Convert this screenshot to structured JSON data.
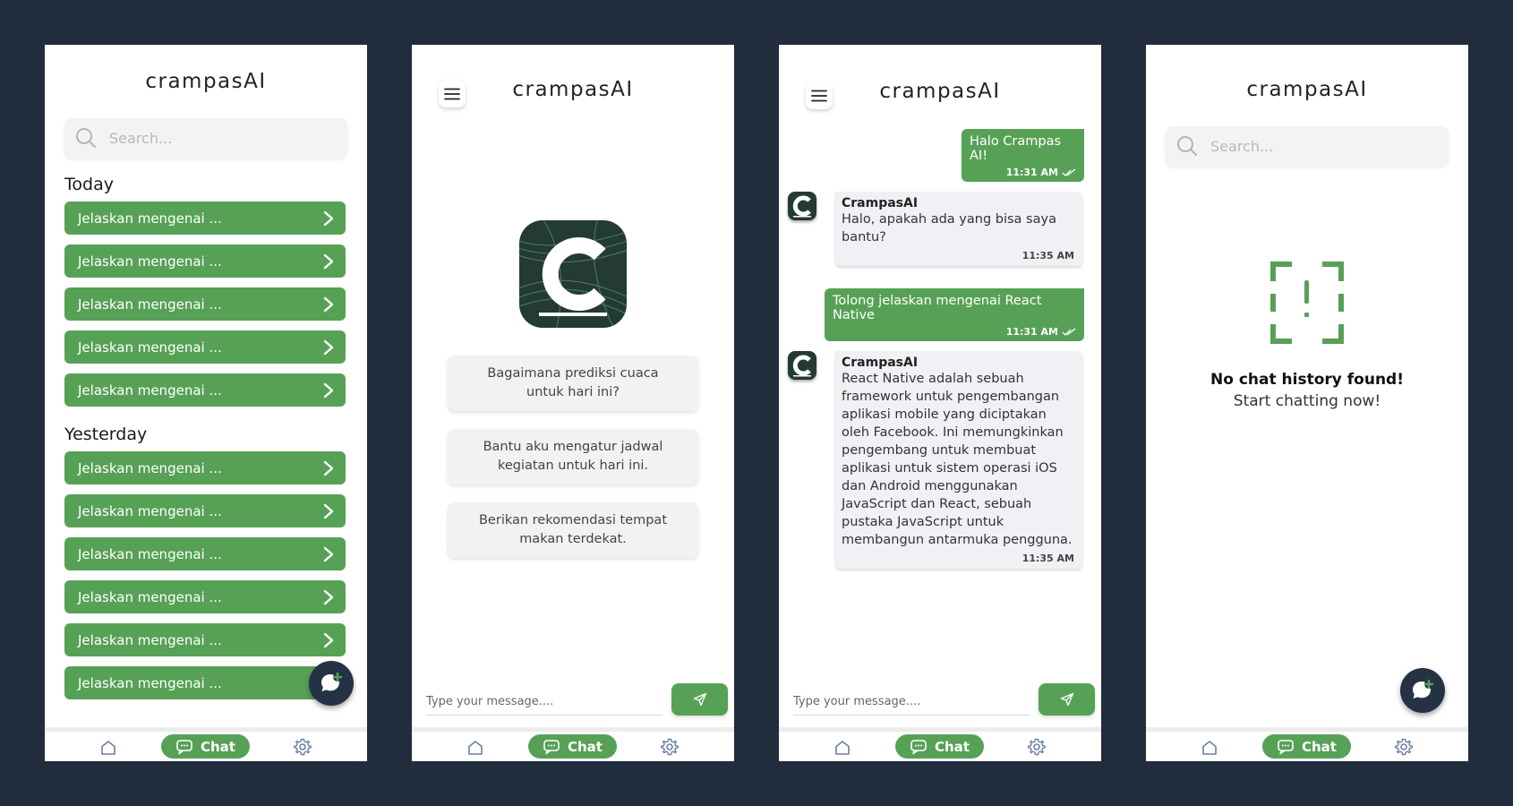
{
  "app": {
    "title": "crampasAI"
  },
  "colors": {
    "background": "#212d3d",
    "accent": "#57a157",
    "fab": "#243244",
    "logo_bg": "#233a35"
  },
  "search": {
    "placeholder": "Search..."
  },
  "history": {
    "today_label": "Today",
    "yesterday_label": "Yesterday",
    "item_label": "Jelaskan mengenai ...",
    "today_count": 5,
    "yesterday_count": 6
  },
  "nav": {
    "chat_label": "Chat",
    "home_icon": "home-icon",
    "settings_icon": "gear-icon"
  },
  "suggestions": [
    "Bagaimana prediksi cuaca untuk hari ini?",
    "Bantu aku mengatur jadwal kegiatan untuk hari ini.",
    "Berikan rekomendasi tempat makan terdekat."
  ],
  "composer": {
    "placeholder": "Type your message...."
  },
  "conversation": {
    "bot_name": "CrampasAI",
    "messages": [
      {
        "from": "user",
        "text": "Halo Crampas AI!",
        "time": "11:31 AM"
      },
      {
        "from": "bot",
        "text": "Halo, apakah ada yang bisa saya bantu?",
        "time": "11:35 AM"
      },
      {
        "from": "user",
        "text": "Tolong jelaskan mengenai React Native",
        "time": "11:31 AM"
      },
      {
        "from": "bot",
        "text": "React Native adalah sebuah framework untuk pengembangan aplikasi mobile yang diciptakan oleh Facebook. Ini memungkinkan pengembang untuk membuat aplikasi untuk sistem operasi iOS dan Android menggunakan JavaScript dan React, sebuah pustaka JavaScript untuk membangun antarmuka pengguna.",
        "time": "11:35 AM"
      }
    ]
  },
  "empty_state": {
    "title": "No chat history found!",
    "subtitle": "Start chatting now!"
  }
}
